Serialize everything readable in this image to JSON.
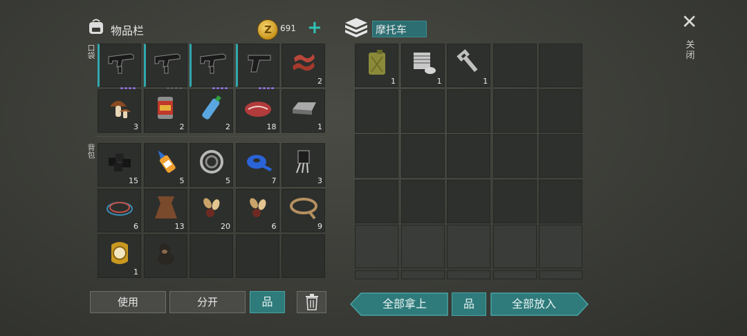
{
  "inventory": {
    "title": "物品栏",
    "coins": "691",
    "coin_symbol": "Z",
    "pocket_label": "口袋",
    "backpack_label": "背包"
  },
  "vehicle": {
    "name": "摩托车"
  },
  "close": {
    "symbol": "✕",
    "label": "关闭"
  },
  "pocket_items": [
    {
      "icon": "smg-icon",
      "count": "",
      "quality_dots": [
        "#8b6fd8",
        "#8b6fd8",
        "#8b6fd8",
        "#8b6fd8"
      ]
    },
    {
      "icon": "smg-icon",
      "count": "",
      "quality_dots": [
        "#5c5c5c",
        "#5c5c5c",
        "#5c5c5c",
        "#5c5c5c"
      ]
    },
    {
      "icon": "smg-icon",
      "count": "",
      "quality_dots": [
        "#8b6fd8",
        "#8b6fd8",
        "#8b6fd8",
        "#8b6fd8"
      ]
    },
    {
      "icon": "pistol-icon",
      "count": "",
      "quality_dots": [
        "#8b6fd8",
        "#8b6fd8",
        "#8b6fd8",
        "#8b6fd8"
      ]
    },
    {
      "icon": "bacon-icon",
      "count": "2"
    },
    {
      "icon": "mushroom-icon",
      "count": "3"
    },
    {
      "icon": "canned-food-icon",
      "count": "2"
    },
    {
      "icon": "water-bottle-icon",
      "count": "2"
    },
    {
      "icon": "raw-meat-icon",
      "count": "18"
    },
    {
      "icon": "iron-ingot-icon",
      "count": "1"
    }
  ],
  "backpack_items": [
    {
      "icon": "coal-icon",
      "count": "15"
    },
    {
      "icon": "glue-icon",
      "count": "5"
    },
    {
      "icon": "bearing-icon",
      "count": "5"
    },
    {
      "icon": "tape-icon",
      "count": "7"
    },
    {
      "icon": "transistor-icon",
      "count": "3"
    },
    {
      "icon": "wire-icon",
      "count": "6"
    },
    {
      "icon": "leather-icon",
      "count": "13"
    },
    {
      "icon": "seeds-icon",
      "count": "20"
    },
    {
      "icon": "seeds-icon",
      "count": "6"
    },
    {
      "icon": "rope-icon",
      "count": "9"
    },
    {
      "icon": "gold-watch-icon",
      "count": "1"
    },
    {
      "icon": "dog-icon",
      "count": ""
    },
    {
      "icon": "",
      "count": ""
    },
    {
      "icon": "",
      "count": ""
    },
    {
      "icon": "",
      "count": ""
    }
  ],
  "vehicle_items": [
    {
      "icon": "jerrycan-icon",
      "count": "1"
    },
    {
      "icon": "engine-cylinder-icon",
      "count": "1"
    },
    {
      "icon": "wrench-icon",
      "count": "1"
    }
  ],
  "buttons": {
    "use": "使用",
    "split": "分开",
    "sort_symbol": "品",
    "take_all": "全部拿上",
    "put_all": "全部放入"
  },
  "colors": {
    "accent": "#31c2b5",
    "teal_button": "#2f7a7a",
    "quality_purple": "#8b6fd8"
  }
}
